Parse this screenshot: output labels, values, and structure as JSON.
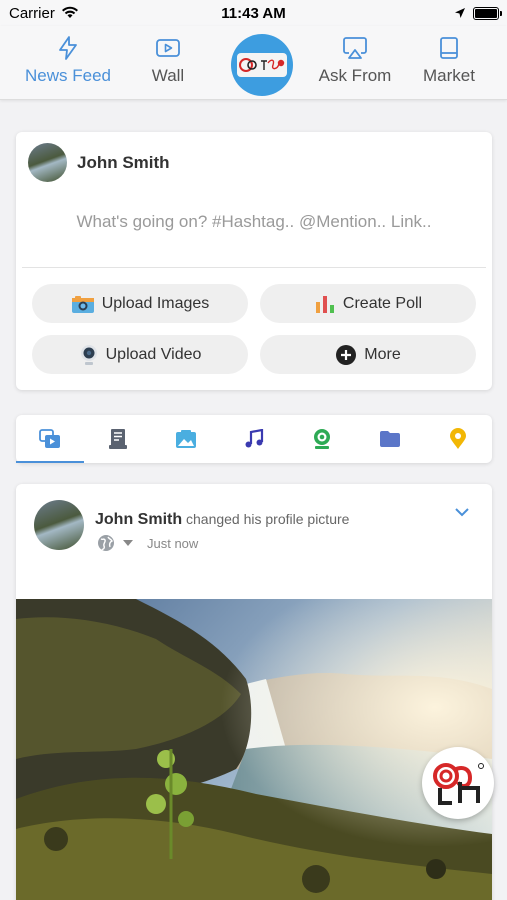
{
  "status": {
    "carrier": "Carrier",
    "time": "11:43 AM"
  },
  "nav": {
    "items": [
      {
        "label": "News Feed",
        "icon": "bolt-icon"
      },
      {
        "label": "Wall",
        "icon": "play-square-icon"
      },
      {
        "label": "Ask From",
        "icon": "airplay-icon"
      },
      {
        "label": "Market",
        "icon": "book-icon"
      }
    ],
    "active": "News Feed",
    "accent": "#4a90d9"
  },
  "composer": {
    "user": "John Smith",
    "placeholder": "What's going on? #Hashtag.. @Mention.. Link..",
    "actions": {
      "upload_images": "Upload Images",
      "create_poll": "Create Poll",
      "upload_video": "Upload Video",
      "more": "More"
    }
  },
  "tabs": [
    "feed-icon",
    "articles-icon",
    "photos-icon",
    "music-icon",
    "live-icon",
    "files-icon",
    "places-icon"
  ],
  "post": {
    "user": "John Smith",
    "action": "changed his profile picture",
    "time": "Just now"
  }
}
